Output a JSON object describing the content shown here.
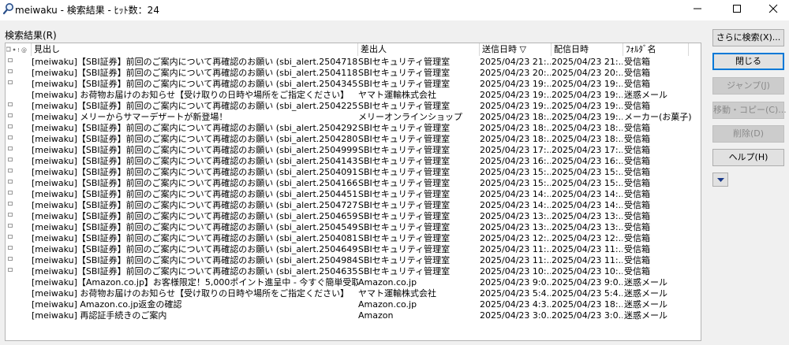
{
  "window": {
    "title": "meiwaku - 検索結果 - ﾋｯﾄ数：24"
  },
  "section_label": "検索結果(R)",
  "columns": {
    "flags": "",
    "subject": "見出し",
    "sender": "差出人",
    "sent": "送信日時 ▽",
    "delivered": "配信日時",
    "folder": "ﾌｫﾙﾀﾞ名"
  },
  "rows": [
    {
      "subject": "[meiwaku]【SBI証券】前回のご案内について再確認のお願い (sbi_alert.25047183-...",
      "sender": "SBIセキュリティ管理室",
      "sent": "2025/04/23 21:...",
      "delivered": "2025/04/23 21:...",
      "folder": "受信箱",
      "envelope": true
    },
    {
      "subject": "[meiwaku]【SBI証券】前回のご案内について再確認のお願い (sbi_alert.25041185-...",
      "sender": "SBIセキュリティ管理室",
      "sent": "2025/04/23 20:...",
      "delivered": "2025/04/23 20:...",
      "folder": "受信箱",
      "envelope": true
    },
    {
      "subject": "[meiwaku]【SBI証券】前回のご案内について再確認のお願い (sbi_alert.25043454-...",
      "sender": "SBIセキュリティ管理室",
      "sent": "2025/04/23 19:...",
      "delivered": "2025/04/23 19:...",
      "folder": "受信箱",
      "envelope": true
    },
    {
      "subject": "[meiwaku] お荷物お届けのお知らせ【受け取りの日時や場所をご指定ください】",
      "sender": "ヤマト運輸株式会社",
      "sent": "2025/04/23 19:...",
      "delivered": "2025/04/23 19:...",
      "folder": "迷惑メール",
      "envelope": false
    },
    {
      "subject": "[meiwaku]【SBI証券】前回のご案内について再確認のお願い (sbi_alert.25042251-...",
      "sender": "SBIセキュリティ管理室",
      "sent": "2025/04/23 19:...",
      "delivered": "2025/04/23 19:...",
      "folder": "受信箱",
      "envelope": true
    },
    {
      "subject": "[meiwaku] メリーからサマーデザートが新登場！",
      "sender": "メリーオンラインショップ",
      "sent": "2025/04/23 18:...",
      "delivered": "2025/04/23 19:...",
      "folder": "メーカー(お菓子)",
      "envelope": true
    },
    {
      "subject": "[meiwaku]【SBI証券】前回のご案内について再確認のお願い (sbi_alert.25042929-...",
      "sender": "SBIセキュリティ管理室",
      "sent": "2025/04/23 18:...",
      "delivered": "2025/04/23 18:...",
      "folder": "受信箱",
      "envelope": true
    },
    {
      "subject": "[meiwaku]【SBI証券】前回のご案内について再確認のお願い (sbi_alert.25042806-...",
      "sender": "SBIセキュリティ管理室",
      "sent": "2025/04/23 18:...",
      "delivered": "2025/04/23 18:...",
      "folder": "受信箱",
      "envelope": true
    },
    {
      "subject": "[meiwaku]【SBI証券】前回のご案内について再確認のお願い (sbi_alert.25049992-...",
      "sender": "SBIセキュリティ管理室",
      "sent": "2025/04/23 17:...",
      "delivered": "2025/04/23 17:...",
      "folder": "受信箱",
      "envelope": true
    },
    {
      "subject": "[meiwaku]【SBI証券】前回のご案内について再確認のお願い (sbi_alert.25041435-...",
      "sender": "SBIセキュリティ管理室",
      "sent": "2025/04/23 16:...",
      "delivered": "2025/04/23 16:...",
      "folder": "受信箱",
      "envelope": true
    },
    {
      "subject": "[meiwaku]【SBI証券】前回のご案内について再確認のお願い (sbi_alert.25040919-...",
      "sender": "SBIセキュリティ管理室",
      "sent": "2025/04/23 15:...",
      "delivered": "2025/04/23 15:...",
      "folder": "受信箱",
      "envelope": true
    },
    {
      "subject": "[meiwaku]【SBI証券】前回のご案内について再確認のお願い (sbi_alert.25041665-...",
      "sender": "SBIセキュリティ管理室",
      "sent": "2025/04/23 15:...",
      "delivered": "2025/04/23 15:...",
      "folder": "受信箱",
      "envelope": true
    },
    {
      "subject": "[meiwaku]【SBI証券】前回のご案内について再確認のお願い (sbi_alert.25044514-...",
      "sender": "SBIセキュリティ管理室",
      "sent": "2025/04/23 14:...",
      "delivered": "2025/04/23 14:...",
      "folder": "受信箱",
      "envelope": true
    },
    {
      "subject": "[meiwaku]【SBI証券】前回のご案内について再確認のお願い (sbi_alert.25047271-...",
      "sender": "SBIセキュリティ管理室",
      "sent": "2025/04/23 14:...",
      "delivered": "2025/04/23 14:...",
      "folder": "受信箱",
      "envelope": true
    },
    {
      "subject": "[meiwaku]【SBI証券】前回のご案内について再確認のお願い (sbi_alert.25046598-...",
      "sender": "SBIセキュリティ管理室",
      "sent": "2025/04/23 13:...",
      "delivered": "2025/04/23 13:...",
      "folder": "受信箱",
      "envelope": true
    },
    {
      "subject": "[meiwaku]【SBI証券】前回のご案内について再確認のお願い (sbi_alert.25045492-...",
      "sender": "SBIセキュリティ管理室",
      "sent": "2025/04/23 13:...",
      "delivered": "2025/04/23 13:...",
      "folder": "受信箱",
      "envelope": true
    },
    {
      "subject": "[meiwaku]【SBI証券】前回のご案内について再確認のお願い (sbi_alert.25040816-...",
      "sender": "SBIセキュリティ管理室",
      "sent": "2025/04/23 12:...",
      "delivered": "2025/04/23 12:...",
      "folder": "受信箱",
      "envelope": true
    },
    {
      "subject": "[meiwaku]【SBI証券】前回のご案内について再確認のお願い (sbi_alert.25046491-...",
      "sender": "SBIセキュリティ管理室",
      "sent": "2025/04/23 11:...",
      "delivered": "2025/04/23 11:...",
      "folder": "受信箱",
      "envelope": true
    },
    {
      "subject": "[meiwaku]【SBI証券】前回のご案内について再確認のお願い (sbi_alert.25049844-...",
      "sender": "SBIセキュリティ管理室",
      "sent": "2025/04/23 11:...",
      "delivered": "2025/04/23 11:...",
      "folder": "受信箱",
      "envelope": true
    },
    {
      "subject": "[meiwaku]【SBI証券】前回のご案内について再確認のお願い (sbi_alert.25046354-...",
      "sender": "SBIセキュリティ管理室",
      "sent": "2025/04/23 10:...",
      "delivered": "2025/04/23 10:...",
      "folder": "受信箱",
      "envelope": true
    },
    {
      "subject": "[meiwaku]【Amazon.co.jp】お客様限定！5,000ポイント進呈中 - 今すぐ簡単受取！",
      "sender": "Amazon.co.jp",
      "sent": "2025/04/23 9:0...",
      "delivered": "2025/04/23 9:0...",
      "folder": "迷惑メール",
      "envelope": false
    },
    {
      "subject": "[meiwaku] お荷物お届けのお知らせ【受け取りの日時や場所をご指定ください】",
      "sender": "ヤマト運輸株式会社",
      "sent": "2025/04/23 5:4...",
      "delivered": "2025/04/23 5:4...",
      "folder": "迷惑メール",
      "envelope": false
    },
    {
      "subject": "[meiwaku] Amazon.co.jp返金の確認",
      "sender": "Amazon.co.jp",
      "sent": "2025/04/23 4:3...",
      "delivered": "2025/04/23 18:...",
      "folder": "迷惑メール",
      "envelope": false
    },
    {
      "subject": "[meiwaku] 再認証手続きのご案内",
      "sender": "Amazon",
      "sent": "2025/04/23 3:0...",
      "delivered": "2025/04/23 3:0...",
      "folder": "迷惑メール",
      "envelope": false
    }
  ],
  "buttons": {
    "search_more": "さらに検索(X)...",
    "close": "閉じる",
    "jump": "ジャンプ(J)",
    "move_copy": "移動・コピー(C)...",
    "delete": "削除(D)",
    "help": "ヘルプ(H)"
  }
}
